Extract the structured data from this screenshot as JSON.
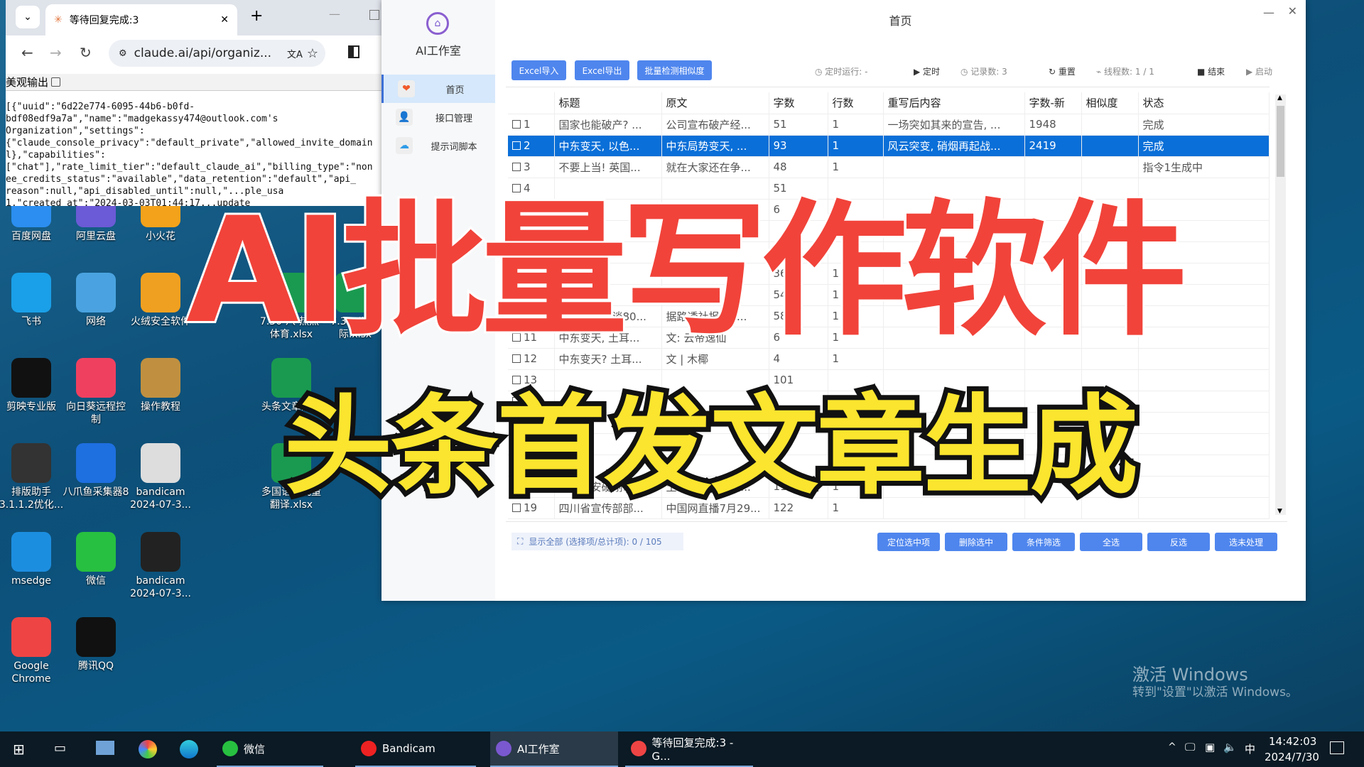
{
  "browser": {
    "tab_title": "等待回复完成:3",
    "url": "claude.ai/api/organiz...",
    "pretty_label": "美观输出",
    "json_lines": [
      "[{\"uuid\":\"6d22e774-6095-44b6-b0fd-",
      "bdf08edf9a7a\",\"name\":\"madgekassy474@outlook.com's",
      "Organization\",\"settings\":",
      "{\"claude_console_privacy\":\"default_private\",\"allowed_invite_domain",
      "l},\"capabilities\":",
      "[\"chat\"],\"rate_limit_tier\":\"default_claude_ai\",\"billing_type\":\"non",
      "ee_credits_status\":\"available\",\"data_retention\":\"default\",\"api_",
      "reason\":null,\"api_disabled_until\":null,\"...ple_usa",
      "1,\"created_at\":\"2024-03-03T01:44:17...update"
    ]
  },
  "desktop": {
    "icons": [
      "百度网盘",
      "阿里云盘",
      "小火花",
      "飞书",
      "网络",
      "火绒安全软件",
      "7.30-八-热点-体育.xlsx",
      "7.30-八-国际.xlsx",
      "剪映专业版",
      "向日葵远程控制",
      "操作教程",
      "头条文章洗稿",
      "排版助手3.1.1.2优化...",
      "八爪鱼采集器8",
      "bandicam 2024-07-3...",
      "多国语言批量翻译.xlsx",
      "msedge",
      "微信",
      "bandicam 2024-07-3...",
      "Google Chrome",
      "腾讯QQ"
    ]
  },
  "app": {
    "name": "AI工作室",
    "window_title": "首页",
    "sidebar": [
      {
        "label": "首页",
        "icon": "heart-icon"
      },
      {
        "label": "接口管理",
        "icon": "user-icon"
      },
      {
        "label": "提示词脚本",
        "icon": "cloud-icon"
      }
    ],
    "toolbar": {
      "excel_import": "Excel导入",
      "excel_export": "Excel导出",
      "batch_check": "批量检测相似度",
      "timer_run": "定时运行: -",
      "timer": "定时",
      "records": "记录数: 3",
      "reset": "重置",
      "threads": "线程数: 1 / 1",
      "stop": "结束",
      "start": "启动"
    },
    "columns": [
      "标题",
      "原文",
      "字数",
      "行数",
      "重写后内容",
      "字数-新",
      "相似度",
      "状态"
    ],
    "rows": [
      [
        "1",
        "国家也能破产? ...",
        "公司宣布破产经...",
        "51",
        "1",
        "一场突如其来的宣告, ...",
        "1948",
        "",
        "完成"
      ],
      [
        "2",
        "中东变天, 以色...",
        "中东局势变天, ...",
        "93",
        "1",
        "风云突变, 硝烟再起战...",
        "2419",
        "",
        "完成"
      ],
      [
        "3",
        "不要上当! 英国...",
        "就在大家还在争...",
        "48",
        "1",
        "",
        "",
        "",
        "指令1生成中"
      ],
      [
        "4",
        "",
        "",
        "51",
        "",
        "",
        "",
        "",
        ""
      ],
      [
        "5",
        "",
        "",
        "6",
        "",
        "",
        "",
        "",
        ""
      ],
      [
        "6",
        "",
        "",
        "",
        "",
        "",
        "",
        "",
        ""
      ],
      [
        "7",
        "",
        "",
        "",
        "",
        "",
        "",
        "",
        ""
      ],
      [
        "8",
        "",
        "",
        "36",
        "1",
        "",
        "",
        "",
        ""
      ],
      [
        "9",
        "",
        "",
        "54",
        "1",
        "",
        "",
        "",
        ""
      ],
      [
        "10",
        "中美外长会谈80...",
        "据路透社报道, ...",
        "58",
        "1",
        "",
        "",
        "",
        ""
      ],
      [
        "11",
        "中东变天, 土耳...",
        "文: 云帝逸仙",
        "6",
        "1",
        "",
        "",
        "",
        ""
      ],
      [
        "12",
        "中东变天? 土耳...",
        "文 | 木椰",
        "4",
        "1",
        "",
        "",
        "",
        ""
      ],
      [
        "13",
        "",
        "",
        "101",
        "",
        "",
        "",
        "",
        ""
      ],
      [
        "14",
        "",
        "",
        "",
        "",
        "",
        "",
        "",
        ""
      ],
      [
        "15",
        "",
        "",
        "",
        "",
        "",
        "",
        "",
        ""
      ],
      [
        "16",
        "",
        "",
        "",
        "",
        "",
        "",
        "",
        ""
      ],
      [
        "17",
        "",
        "",
        "",
        "",
        "",
        "",
        "",
        ""
      ],
      [
        "18",
        "埃尔多安硬刚以...",
        "土耳其不满以色...",
        "112",
        "1",
        "",
        "",
        "",
        ""
      ],
      [
        "19",
        "四川省宣传部部...",
        "中国网直播7月29...",
        "122",
        "1",
        "",
        "",
        "",
        ""
      ]
    ],
    "selected_row": 2,
    "footer": {
      "status": "显示全部 (选择项/总计项): 0 / 105",
      "buttons": [
        "定位选中项",
        "删除选中",
        "条件筛选",
        "全选",
        "反选",
        "选未处理"
      ]
    }
  },
  "overlay": {
    "headline": "AI批量写作软件",
    "subheadline": "头条首发文章生成"
  },
  "watermark": {
    "line1": "激活 Windows",
    "line2": "转到\"设置\"以激活 Windows。"
  },
  "taskbar": {
    "items": [
      "微信",
      "Bandicam",
      "AI工作室",
      "等待回复完成:3 - G..."
    ],
    "time": "14:42:03",
    "date": "2024/7/30",
    "ime": "中"
  },
  "colors": {
    "accent": "#4f86ee",
    "selected": "#0a6fd8",
    "headline": "#f1433a",
    "subheadline": "#fbe52e"
  }
}
